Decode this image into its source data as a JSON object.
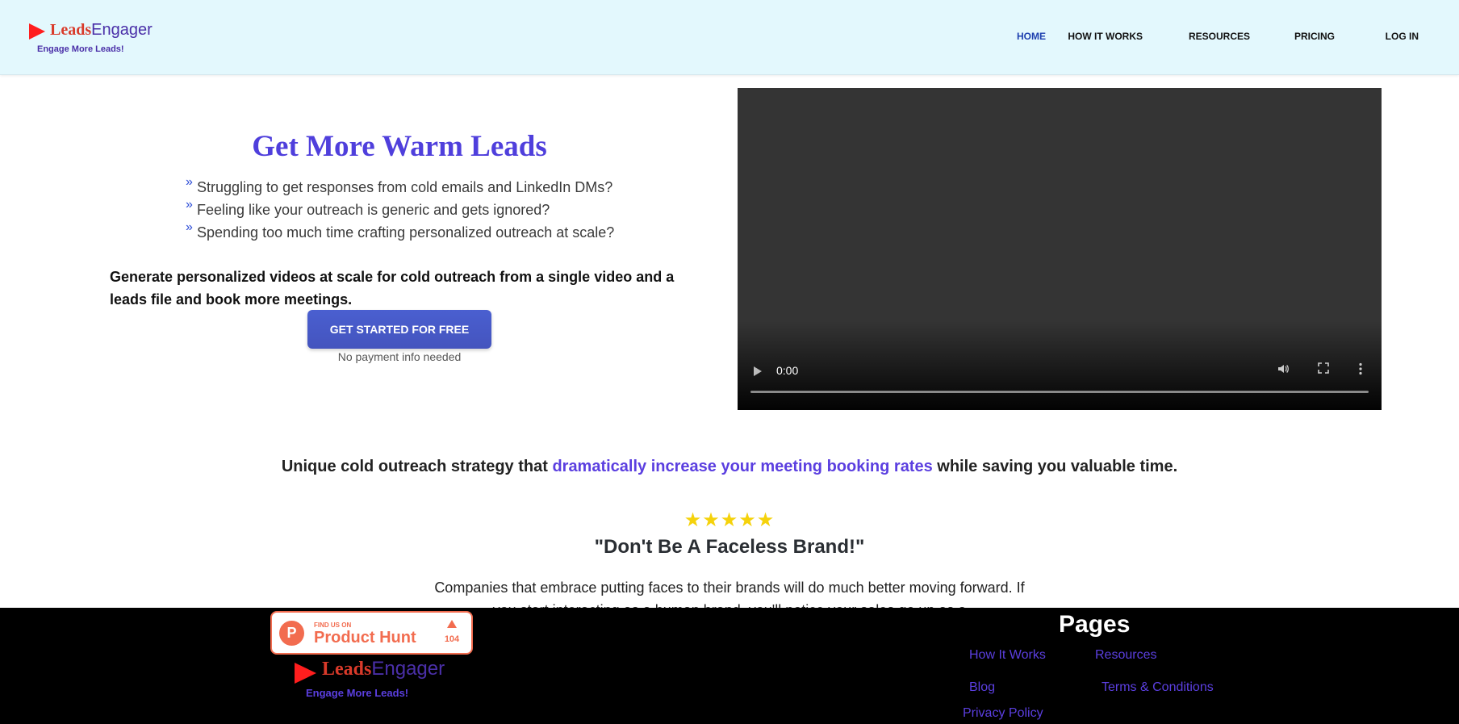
{
  "header": {
    "brand_leads": "Leads",
    "brand_engager": "Engager",
    "tagline": "Engage More Leads!",
    "nav": [
      {
        "label": "HOME",
        "active": true
      },
      {
        "label": "HOW IT WORKS",
        "active": false
      },
      {
        "label": "RESOURCES",
        "active": false
      },
      {
        "label": "PRICING",
        "active": false
      },
      {
        "label": "LOG IN",
        "active": false
      }
    ]
  },
  "hero": {
    "title": "Get More Warm Leads",
    "bullets": [
      "Struggling to get responses from cold emails and LinkedIn DMs?",
      "Feeling like your outreach is generic and gets ignored?",
      "Spending too much time crafting personalized outreach at scale?"
    ],
    "bullet_glyph": "»",
    "description": "Generate personalized videos at scale for cold outreach from a single video and a leads file and book more meetings.",
    "cta_label": "GET STARTED FOR FREE",
    "cta_note": "No payment info needed"
  },
  "video": {
    "time": "0:00",
    "progress": 0
  },
  "strategy": {
    "before": "Unique cold outreach strategy that ",
    "highlight": "dramatically increase your meeting booking rates",
    "after": " while saving you valuable time."
  },
  "testimonial": {
    "stars": "★★★★★",
    "rating": 5,
    "quote": "\"Don't Be A Faceless Brand!\"",
    "body": "Companies that embrace putting faces to their brands will do much better moving forward. If you start interacting as a human brand, you'll notice your sales go up as a"
  },
  "footer": {
    "product_hunt": {
      "find_us": "FIND US ON",
      "name": "Product Hunt",
      "logo_letter": "P",
      "count": "104"
    },
    "brand_leads": "Leads",
    "brand_engager": "Engager",
    "tagline": "Engage More Leads!",
    "pages_title": "Pages",
    "links": [
      "How It Works",
      "Resources",
      "Blog",
      "Terms & Conditions",
      "Privacy Policy"
    ]
  },
  "colors": {
    "header_bg": "#e3f8fd",
    "accent_purple": "#5b3fe0",
    "nav_active": "#1e40af",
    "cta_bg": "#4a5fd0",
    "star": "#f5d20b",
    "product_hunt": "#f26c4f",
    "footer_bg": "#000000"
  }
}
